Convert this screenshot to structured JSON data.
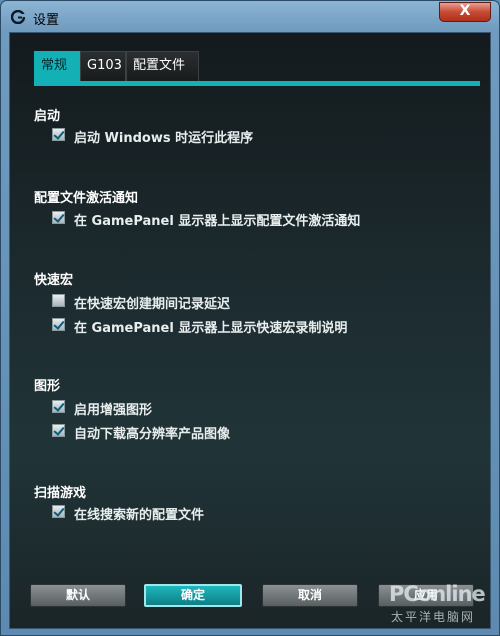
{
  "window": {
    "title": "设置",
    "close_glyph": "X"
  },
  "tabs": [
    {
      "label": "常规",
      "active": true
    },
    {
      "label": "G103",
      "active": false
    },
    {
      "label": "配置文件",
      "active": false
    }
  ],
  "sections": [
    {
      "title": "启动",
      "options": [
        {
          "label": "启动 Windows 时运行此程序",
          "checked": true
        }
      ]
    },
    {
      "title": "配置文件激活通知",
      "options": [
        {
          "label": "在 GamePanel 显示器上显示配置文件激活通知",
          "checked": true
        }
      ]
    },
    {
      "title": "快速宏",
      "options": [
        {
          "label": "在快速宏创建期间记录延迟",
          "checked": false
        },
        {
          "label": "在 GamePanel 显示器上显示快速宏录制说明",
          "checked": true
        }
      ]
    },
    {
      "title": "图形",
      "options": [
        {
          "label": "启用增强图形",
          "checked": true
        },
        {
          "label": "自动下载高分辨率产品图像",
          "checked": true
        }
      ]
    },
    {
      "title": "扫描游戏",
      "options": [
        {
          "label": "在线搜索新的配置文件",
          "checked": true
        }
      ]
    }
  ],
  "buttons": {
    "default": "默认",
    "ok": "确定",
    "cancel": "取消",
    "apply": "应用"
  },
  "watermark": {
    "brand": "PConline",
    "sub": "太平洋电脑网"
  },
  "colors": {
    "accent": "#13b0b5",
    "background": "#1c2a2e"
  },
  "icons": {
    "app": "logitech-g-logo-icon",
    "checkbox": "checkmark-icon"
  }
}
